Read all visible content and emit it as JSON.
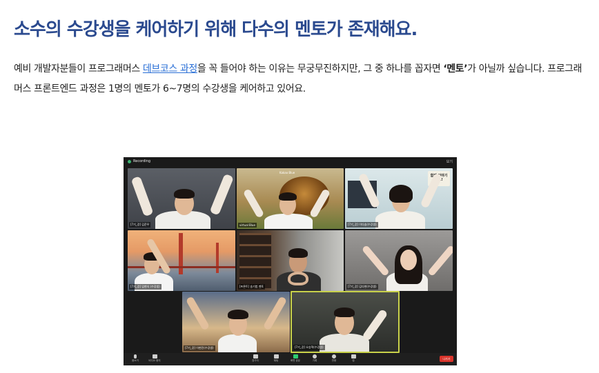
{
  "heading": "소수의 수강생을 케어하기 위해 다수의 멘토가 존재해요.",
  "paragraph": {
    "part1": "예비 개발자분들이 프로그래머스 ",
    "link": "데브코스 과정",
    "part2": "을 꼭 들어야 하는 이유는 무궁무진하지만, 그 중 하나를 꼽자면 ",
    "bold": "‘멘토’",
    "part3": "가 아닐까 싶습니다. 프로그래머스 프론트엔드 과정은 1명의 멘토가 6~7명의 수강생을 케어하고 있어요."
  },
  "zoom": {
    "recording_label": "Recording",
    "view_label": "보기",
    "tiles": [
      {
        "name": "[7기_강] 김준우"
      },
      {
        "name": "virtual Blue"
      },
      {
        "name": "[7기_강] 이다솜(수강생)"
      },
      {
        "name": "[7기_강] 임현식 (수강생)"
      },
      {
        "name": "[프론트] 송기범 멘토"
      },
      {
        "name": "[7기_강] 김다현(수강생)"
      },
      {
        "name": "[7기_강] 이현진(수강생)"
      },
      {
        "name": "[7기_강] 오승혁(수강생)"
      }
    ],
    "sign_text": "함께 이야기 해요!",
    "virtual_bg_label": "Kakao Blue",
    "toolbar": {
      "mute": "음소거",
      "video": "비디오 중지",
      "participants": "참가자",
      "chat": "채팅",
      "share": "화면 공유",
      "record": "기록",
      "reactions": "반응",
      "apps": "앱",
      "leave": "나가기"
    }
  }
}
